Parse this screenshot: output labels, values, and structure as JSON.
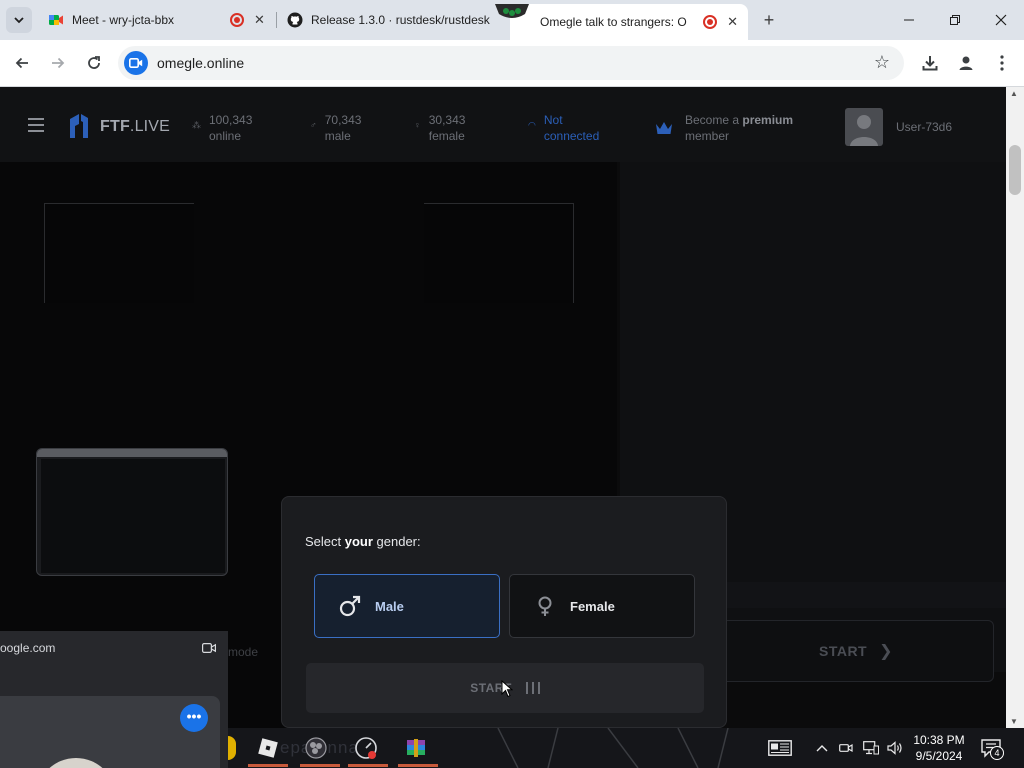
{
  "browser": {
    "tabs": [
      {
        "title": "Meet - wry-jcta-bbx",
        "active": false
      },
      {
        "title": "Release 1.3.0 · rustdesk/rustdesk",
        "active": false
      },
      {
        "title": "Omegle talk to strangers: O",
        "active": true
      }
    ],
    "url": "omegle.online"
  },
  "site": {
    "logo_bold": "FTF",
    "logo_rest": ".LIVE",
    "stats": [
      {
        "value": "100,343",
        "label": "online"
      },
      {
        "value": "70,343",
        "label": "male"
      },
      {
        "value": "30,343",
        "label": "female"
      },
      {
        "value": "Not",
        "label": "connected"
      }
    ],
    "premium_prefix": "Become a ",
    "premium_bold": "premium",
    "premium_suffix": "member",
    "username": "User-73d6",
    "start_label": "START",
    "mode_text": "mode"
  },
  "dialog": {
    "title_prefix": "Select ",
    "title_bold": "your",
    "title_suffix": " gender:",
    "male_label": "Male",
    "female_label": "Female",
    "start_label": "START",
    "selected": "male"
  },
  "popup": {
    "url": "oogle.com"
  },
  "taskbar": {
    "search_text": "epa onna",
    "time": "10:38 PM",
    "date": "9/5/2024",
    "notifications": "4"
  },
  "colors": {
    "accent": "#3a6fc4",
    "chrome_blue": "#1a73e8",
    "record_red": "#d93025"
  }
}
